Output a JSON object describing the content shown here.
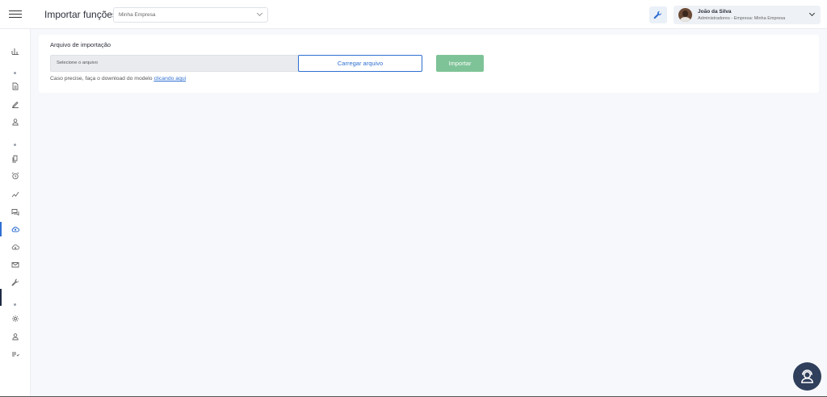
{
  "header": {
    "title": "Importar funções",
    "company_select": {
      "value": "Minha Empresa"
    },
    "user": {
      "name": "João da Silva",
      "role": "Administradores - Empresa: Minha Empresa"
    }
  },
  "sidebar": {
    "items": [
      {
        "icon": "bar-chart-icon"
      },
      {
        "icon": "document-icon"
      },
      {
        "icon": "pencil-icon"
      },
      {
        "icon": "person-icon"
      },
      {
        "icon": "copy-icon"
      },
      {
        "icon": "alarm-clock-icon"
      },
      {
        "icon": "trend-line-icon"
      },
      {
        "icon": "chat-icon"
      },
      {
        "icon": "cloud-upload-icon",
        "active": true
      },
      {
        "icon": "cloud-download-icon"
      },
      {
        "icon": "mail-icon"
      },
      {
        "icon": "wrench-icon"
      },
      {
        "icon": "gear-icon"
      },
      {
        "icon": "person-icon"
      },
      {
        "icon": "list-icon"
      }
    ]
  },
  "import_card": {
    "title": "Arquivo de importação",
    "file_placeholder": "Selecione o arquivo",
    "load_button": "Carregar arquivo",
    "import_button": "Importar",
    "hint_text": "Caso precise, faça o download do modelo",
    "hint_link": "clicando aqui"
  },
  "colors": {
    "accent": "#2f6fd1",
    "import_button": "#7ec397",
    "support_button": "#2f3f5c",
    "background": "#f6f8fb"
  }
}
